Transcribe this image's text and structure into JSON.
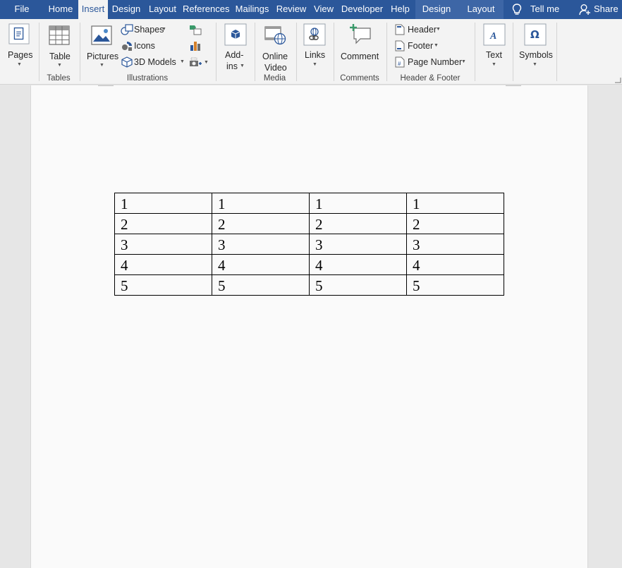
{
  "tabs": [
    {
      "id": "file",
      "label": "File"
    },
    {
      "id": "home",
      "label": "Home"
    },
    {
      "id": "insert",
      "label": "Insert",
      "active": true
    },
    {
      "id": "design",
      "label": "Design"
    },
    {
      "id": "layout",
      "label": "Layout"
    },
    {
      "id": "references",
      "label": "References"
    },
    {
      "id": "mailings",
      "label": "Mailings"
    },
    {
      "id": "review",
      "label": "Review"
    },
    {
      "id": "view",
      "label": "View"
    },
    {
      "id": "developer",
      "label": "Developer"
    },
    {
      "id": "help",
      "label": "Help"
    }
  ],
  "context_tabs": [
    {
      "id": "table-design",
      "label": "Design"
    },
    {
      "id": "table-layout",
      "label": "Layout"
    }
  ],
  "tell_me": "Tell me",
  "share": "Share",
  "ribbon": {
    "pages": "Pages",
    "table": "Table",
    "pictures": "Pictures",
    "shapes": "Shapes",
    "icons": "Icons",
    "models_3d": "3D Models",
    "addins_line1": "Add-",
    "addins_line2": "ins",
    "online_video_line1": "Online",
    "online_video_line2": "Video",
    "links": "Links",
    "comment": "Comment",
    "header": "Header",
    "footer": "Footer",
    "page_number": "Page Number",
    "text": "Text",
    "symbols": "Symbols",
    "groups": {
      "tables": "Tables",
      "illustrations": "Illustrations",
      "media": "Media",
      "comments": "Comments",
      "header_footer": "Header & Footer"
    }
  },
  "document": {
    "table": [
      [
        "1",
        "1",
        "1",
        "1"
      ],
      [
        "2",
        "2",
        "2",
        "2"
      ],
      [
        "3",
        "3",
        "3",
        "3"
      ],
      [
        "4",
        "4",
        "4",
        "4"
      ],
      [
        "5",
        "5",
        "5",
        "5"
      ]
    ]
  },
  "colors": {
    "ribbon_blue": "#2b579a",
    "context_tab": "#3d66a6",
    "ribbon_bg": "#f3f3f3"
  }
}
